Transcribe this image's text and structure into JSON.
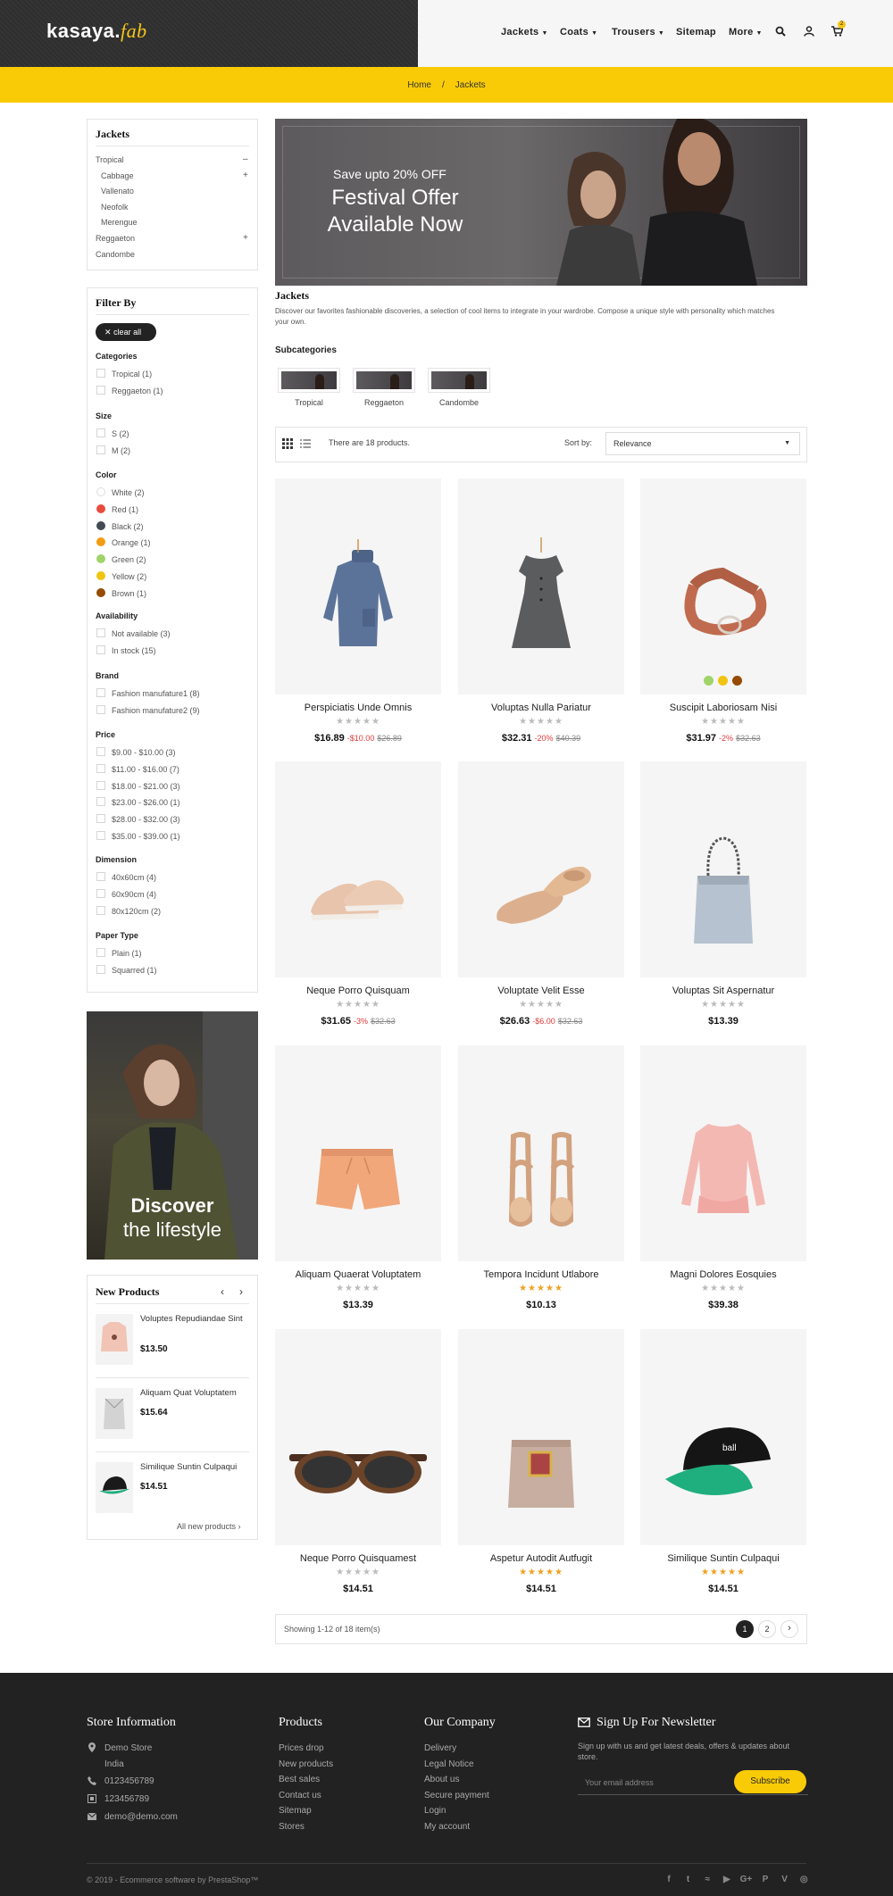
{
  "header": {
    "logo_main": "kasaya.",
    "logo_script": "fab",
    "nav": [
      "Jackets",
      "Coats",
      "Trousers",
      "Sitemap",
      "More"
    ],
    "cart_count": "2",
    "icons": [
      "search-icon",
      "user-icon",
      "cart-icon"
    ]
  },
  "breadcrumb": {
    "home": "Home",
    "sep": "/",
    "current": "Jackets"
  },
  "sidebar": {
    "categories_title": "Jackets",
    "categories": [
      {
        "label": "Tropical",
        "toggle": "–",
        "indent": false
      },
      {
        "label": "Cabbage",
        "toggle": "+",
        "indent": true
      },
      {
        "label": "Vallenato",
        "toggle": "",
        "indent": true
      },
      {
        "label": "Neofolk",
        "toggle": "",
        "indent": true
      },
      {
        "label": "Merengue",
        "toggle": "",
        "indent": true
      },
      {
        "label": "Reggaeton",
        "toggle": "+",
        "indent": false
      },
      {
        "label": "Candombe",
        "toggle": "",
        "indent": false
      }
    ],
    "filter_title": "Filter By",
    "clear_all": "clear all",
    "filters": [
      {
        "heading": "Categories",
        "items": [
          "Tropical (1)",
          "Reggaeton (1)"
        ]
      },
      {
        "heading": "Size",
        "items": [
          "S (2)",
          "M (2)"
        ]
      },
      {
        "heading": "Color",
        "colors": [
          {
            "label": "White (2)",
            "hex": "#ffffff"
          },
          {
            "label": "Red (1)",
            "hex": "#e84c3d"
          },
          {
            "label": "Black (2)",
            "hex": "#434a54"
          },
          {
            "label": "Orange (1)",
            "hex": "#f39c11"
          },
          {
            "label": "Green (2)",
            "hex": "#a0d468"
          },
          {
            "label": "Yellow (2)",
            "hex": "#f1c40f"
          },
          {
            "label": "Brown (1)",
            "hex": "#964b00"
          }
        ]
      },
      {
        "heading": "Availability",
        "items": [
          "Not available (3)",
          "In stock (15)"
        ]
      },
      {
        "heading": "Brand",
        "items": [
          "Fashion manufature1 (8)",
          "Fashion manufature2 (9)"
        ]
      },
      {
        "heading": "Price",
        "items": [
          "$9.00 - $10.00 (3)",
          "$11.00 - $16.00 (7)",
          "$18.00 - $21.00 (3)",
          "$23.00 - $26.00 (1)",
          "$28.00 - $32.00 (3)",
          "$35.00 - $39.00 (1)"
        ]
      },
      {
        "heading": "Dimension",
        "items": [
          "40x60cm (4)",
          "60x90cm (4)",
          "80x120cm (2)"
        ]
      },
      {
        "heading": "Paper Type",
        "items": [
          "Plain (1)",
          "Squarred (1)"
        ]
      }
    ],
    "promo": {
      "line1": "Discover",
      "line2": "the lifestyle"
    },
    "new_products": {
      "title": "New Products",
      "items": [
        {
          "name": "Voluptes Repudiandae Sint",
          "price": "$13.50"
        },
        {
          "name": "Aliquam Quat Voluptatem",
          "price": "$15.64"
        },
        {
          "name": "Similique Suntin Culpaqui",
          "price": "$14.51"
        }
      ],
      "all_link": "All new products ›"
    }
  },
  "banner": {
    "small": "Save upto 20% OFF",
    "line1": "Festival Offer",
    "line2": "Available Now"
  },
  "category": {
    "title": "Jackets",
    "description": "Discover our favorites fashionable discoveries, a selection of cool items to integrate in your wardrobe. Compose a unique style with personality which matches your own.",
    "subcategories_title": "Subcategories",
    "subcategories": [
      "Tropical",
      "Reggaeton",
      "Candombe"
    ]
  },
  "toolbar": {
    "count_text": "There are 18 products.",
    "sort_label": "Sort by:",
    "sort_value": "Relevance"
  },
  "products": [
    {
      "name": "Perspiciatis Unde Omnis",
      "price": "$16.89",
      "discount": "-$10.00",
      "old": "$26.89",
      "stars": "gray",
      "img": "sweater"
    },
    {
      "name": "Voluptas Nulla Pariatur",
      "price": "$32.31",
      "discount": "-20%",
      "old": "$40.39",
      "stars": "gray",
      "img": "dress"
    },
    {
      "name": "Suscipit Laboriosam Nisi",
      "price": "$31.97",
      "discount": "-2%",
      "old": "$32.63",
      "stars": "gray",
      "img": "belt"
    },
    {
      "name": "Neque Porro Quisquam",
      "price": "$31.65",
      "discount": "-3%",
      "old": "$32.63",
      "stars": "gray",
      "img": "sneaker"
    },
    {
      "name": "Voluptate Velit Esse",
      "price": "$26.63",
      "discount": "-$6.00",
      "old": "$32.63",
      "stars": "gray",
      "img": "flat"
    },
    {
      "name": "Voluptas Sit Aspernatur",
      "price": "$13.39",
      "discount": "",
      "old": "",
      "stars": "gray",
      "img": "bag"
    },
    {
      "name": "Aliquam Quaerat Voluptatem",
      "price": "$13.39",
      "discount": "",
      "old": "",
      "stars": "gray",
      "img": "shorts"
    },
    {
      "name": "Tempora Incidunt Utlabore",
      "price": "$10.13",
      "discount": "",
      "old": "",
      "stars": "gold",
      "img": "sandal"
    },
    {
      "name": "Magni Dolores Eosquies",
      "price": "$39.38",
      "discount": "",
      "old": "",
      "stars": "gray",
      "img": "blouse"
    },
    {
      "name": "Neque Porro Quisquamest",
      "price": "$14.51",
      "discount": "",
      "old": "",
      "stars": "gray",
      "img": "sunglasses"
    },
    {
      "name": "Aspetur Autodit Autfugit",
      "price": "$14.51",
      "discount": "",
      "old": "",
      "stars": "gold",
      "img": "wallet"
    },
    {
      "name": "Similique Suntin Culpaqui",
      "price": "$14.51",
      "discount": "",
      "old": "",
      "stars": "gold",
      "img": "cap"
    }
  ],
  "belt_swatches": [
    "#a0d468",
    "#f1c40f",
    "#964b00"
  ],
  "stars_text": "★★★★★",
  "pagination": {
    "showing": "Showing 1-12 of 18 item(s)",
    "pages": [
      "1",
      "2"
    ],
    "next": "›"
  },
  "footer": {
    "store_title": "Store Information",
    "store": [
      "Demo Store",
      "India",
      "0123456789",
      "123456789",
      "demo@demo.com"
    ],
    "products_title": "Products",
    "products": [
      "Prices drop",
      "New products",
      "Best sales",
      "Contact us",
      "Sitemap",
      "Stores"
    ],
    "company_title": "Our Company",
    "company": [
      "Delivery",
      "Legal Notice",
      "About us",
      "Secure payment",
      "Login",
      "My account"
    ],
    "newsletter_title": "Sign Up For Newsletter",
    "newsletter_text": "Sign up with us and get latest deals, offers & updates about store.",
    "email_placeholder": "Your email address",
    "subscribe": "Subscribe",
    "copyright": "© 2019 - Ecommerce software by PrestaShop™",
    "social": [
      "facebook-icon",
      "twitter-icon",
      "rss-icon",
      "youtube-icon",
      "google-plus-icon",
      "pinterest-icon",
      "vimeo-icon",
      "instagram-icon"
    ]
  },
  "colors": {
    "accent": "#f9cb06",
    "dark": "#222222",
    "sale": "#e03b3b"
  }
}
